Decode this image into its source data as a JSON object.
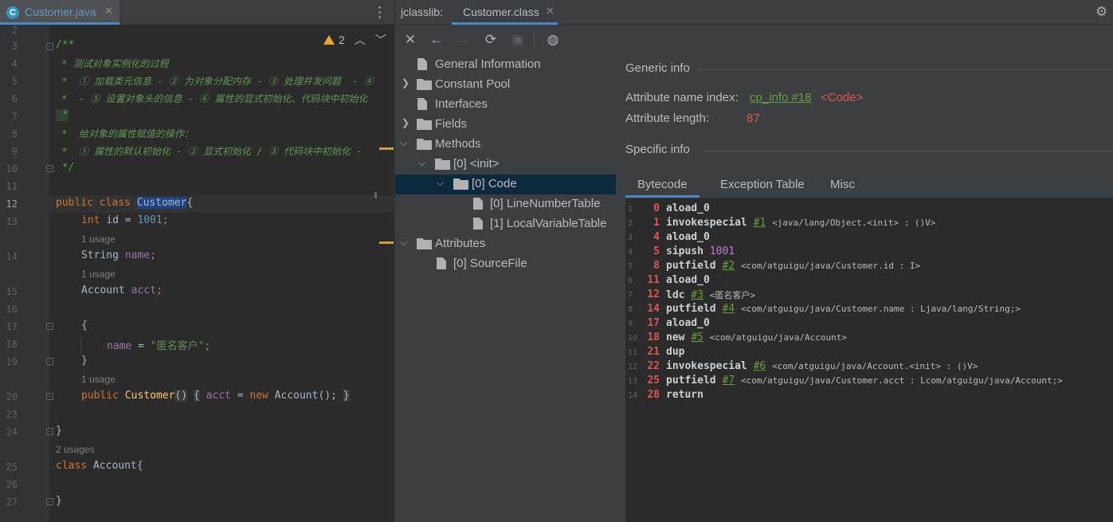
{
  "editor": {
    "tab_label": "Customer.java",
    "tab_icon": "C",
    "inspection_count": "2",
    "line_numbers": [
      "2",
      "3",
      "4",
      "5",
      "6",
      "7",
      "8",
      "9",
      "10",
      "11",
      "12",
      "13",
      "14",
      "15",
      "16",
      "17",
      "18",
      "19",
      "20",
      "23",
      "24",
      "25",
      "26",
      "27"
    ],
    "comment": {
      "l3": "/**",
      "l4": " * 测试对象实例化的过程",
      "l5": " *  ① 加载类元信息 - ② 为对象分配内存 - ③ 处理并发问题  - ④",
      "l6": " *  - ⑤ 设置对象头的信息 - ⑥ 属性的显式初始化、代码块中初始化",
      "l7": " *",
      "l8": " *  给对象的属性赋值的操作：",
      "l9": " *  ① 属性的默认初始化 - ② 显式初始化 / ③ 代码块中初始化 -",
      "l10": " */"
    },
    "code": {
      "kw_public": "public",
      "kw_class": "class",
      "class_name": "Customer",
      "brace_open": "{",
      "kw_int": "int",
      "id_decl": " id = ",
      "id_val": "1001",
      "semi": ";",
      "string_type": "String",
      "name_field": "name",
      "account_type": "Account",
      "acct_field": "acct",
      "block_open": "{",
      "name_assign": " = ",
      "name_val": "\"匿名客户\"",
      "block_close": "}",
      "ctor_name": "Customer",
      "ctor_parens": "()",
      "ctor_body_open": "{",
      "kw_new": "new",
      "ctor_new_call": " Account();",
      "ctor_body_close": "}",
      "class_close": "}",
      "account_class": "Account{",
      "account_close": "}"
    },
    "usages": {
      "one": "1 usage",
      "two": "2 usages"
    }
  },
  "tool": {
    "title": "jclasslib:",
    "tab_label": "Customer.class",
    "tree": [
      {
        "label": "General Information"
      },
      {
        "label": "Constant Pool"
      },
      {
        "label": "Interfaces"
      },
      {
        "label": "Fields"
      },
      {
        "label": "Methods"
      },
      {
        "label": "[0] <init>"
      },
      {
        "label": "[0] Code"
      },
      {
        "label": "[0] LineNumberTable"
      },
      {
        "label": "[1] LocalVariableTable"
      },
      {
        "label": "Attributes"
      },
      {
        "label": "[0] SourceFile"
      }
    ],
    "generic_info": "Generic info",
    "attr_name_index_label": "Attribute name index:",
    "attr_name_index_link": "cp_info #18",
    "attr_name_index_value": "<Code>",
    "attr_length_label": "Attribute length:",
    "attr_length_value": "87",
    "specific_info": "Specific info",
    "bytecode_tabs": [
      "Bytecode",
      "Exception Table",
      "Misc"
    ],
    "bytecode": [
      {
        "n": "1",
        "off": "0",
        "op": "aload_0",
        "ref": "",
        "num": "",
        "cmt": ""
      },
      {
        "n": "2",
        "off": "1",
        "op": "invokespecial",
        "ref": "#1",
        "num": "",
        "cmt": "<java/lang/Object.<init> : ()V>"
      },
      {
        "n": "3",
        "off": "4",
        "op": "aload_0",
        "ref": "",
        "num": "",
        "cmt": ""
      },
      {
        "n": "4",
        "off": "5",
        "op": "sipush",
        "ref": "",
        "num": "1001",
        "cmt": ""
      },
      {
        "n": "5",
        "off": "8",
        "op": "putfield",
        "ref": "#2",
        "num": "",
        "cmt": "<com/atguigu/java/Customer.id : I>"
      },
      {
        "n": "6",
        "off": "11",
        "op": "aload_0",
        "ref": "",
        "num": "",
        "cmt": ""
      },
      {
        "n": "7",
        "off": "12",
        "op": "ldc",
        "ref": "#3",
        "num": "",
        "cmt": "<匿名客户>"
      },
      {
        "n": "8",
        "off": "14",
        "op": "putfield",
        "ref": "#4",
        "num": "",
        "cmt": "<com/atguigu/java/Customer.name : Ljava/lang/String;>"
      },
      {
        "n": "9",
        "off": "17",
        "op": "aload_0",
        "ref": "",
        "num": "",
        "cmt": ""
      },
      {
        "n": "10",
        "off": "18",
        "op": "new",
        "ref": "#5",
        "num": "",
        "cmt": "<com/atguigu/java/Account>"
      },
      {
        "n": "11",
        "off": "21",
        "op": "dup",
        "ref": "",
        "num": "",
        "cmt": ""
      },
      {
        "n": "12",
        "off": "22",
        "op": "invokespecial",
        "ref": "#6",
        "num": "",
        "cmt": "<com/atguigu/java/Account.<init> : ()V>"
      },
      {
        "n": "13",
        "off": "25",
        "op": "putfield",
        "ref": "#7",
        "num": "",
        "cmt": "<com/atguigu/java/Customer.acct : Lcom/atguigu/java/Account;>"
      },
      {
        "n": "14",
        "off": "28",
        "op": "return",
        "ref": "",
        "num": "",
        "cmt": ""
      }
    ]
  },
  "colors": {
    "accent": "#4a88c7",
    "selection": "#0d293e",
    "keyword": "#cc7832",
    "comment": "#629755",
    "offset": "#e05555",
    "link": "#6a9d3a"
  }
}
